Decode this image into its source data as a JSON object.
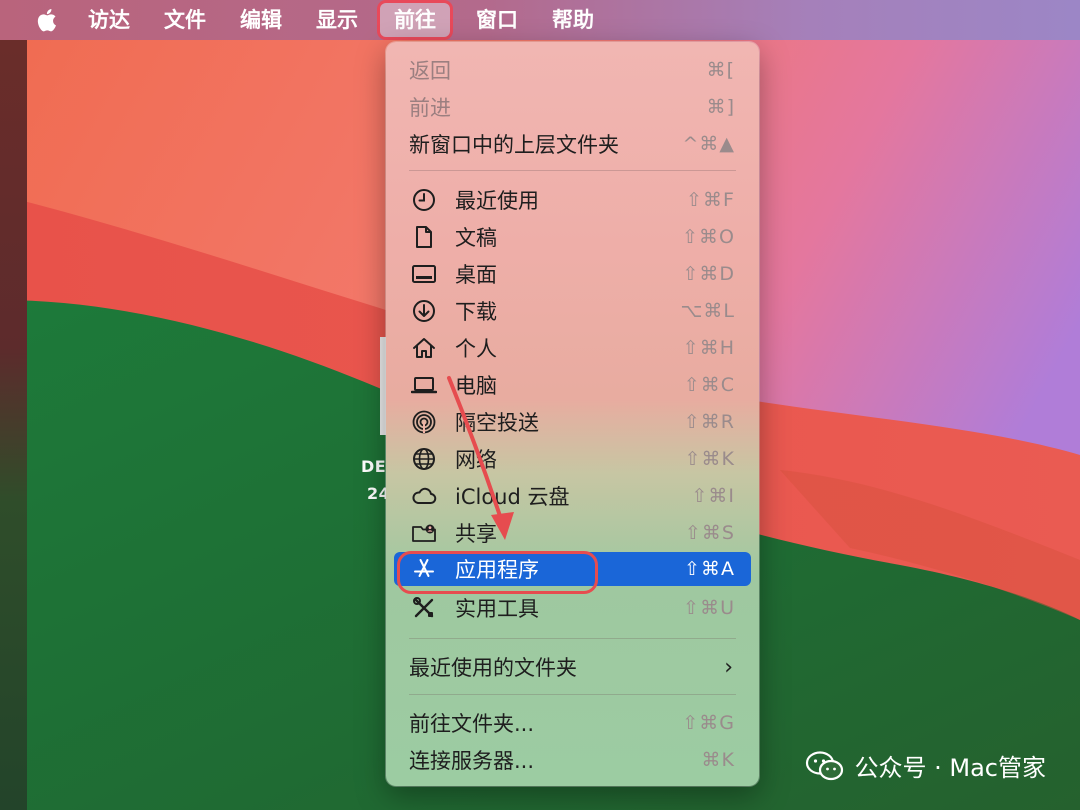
{
  "menubar": {
    "items": [
      {
        "label": "访达",
        "active": false
      },
      {
        "label": "文件",
        "active": false
      },
      {
        "label": "编辑",
        "active": false
      },
      {
        "label": "显示",
        "active": false
      },
      {
        "label": "前往",
        "active": true
      },
      {
        "label": "窗口",
        "active": false
      },
      {
        "label": "帮助",
        "active": false
      }
    ]
  },
  "desktop": {
    "label_line1": "DE",
    "label_line2": "24"
  },
  "go_menu": {
    "back": {
      "label": "返回",
      "shortcut": "⌘[",
      "enabled": false
    },
    "forward": {
      "label": "前进",
      "shortcut": "⌘]",
      "enabled": false
    },
    "enclosing": {
      "label": "新窗口中的上层文件夹",
      "shortcut": "^⌘▲"
    },
    "recents": {
      "label": "最近使用",
      "shortcut": "⇧⌘F",
      "icon": "clock-icon"
    },
    "documents": {
      "label": "文稿",
      "shortcut": "⇧⌘O",
      "icon": "document-icon"
    },
    "desktop": {
      "label": "桌面",
      "shortcut": "⇧⌘D",
      "icon": "desktop-icon"
    },
    "downloads": {
      "label": "下载",
      "shortcut": "⌥⌘L",
      "icon": "download-icon"
    },
    "home": {
      "label": "个人",
      "shortcut": "⇧⌘H",
      "icon": "home-icon"
    },
    "computer": {
      "label": "电脑",
      "shortcut": "⇧⌘C",
      "icon": "laptop-icon"
    },
    "airdrop": {
      "label": "隔空投送",
      "shortcut": "⇧⌘R",
      "icon": "airdrop-icon"
    },
    "network": {
      "label": "网络",
      "shortcut": "⇧⌘K",
      "icon": "globe-icon"
    },
    "icloud": {
      "label": "iCloud 云盘",
      "shortcut": "⇧⌘I",
      "icon": "cloud-icon"
    },
    "shared": {
      "label": "共享",
      "shortcut": "⇧⌘S",
      "icon": "shared-folder-icon"
    },
    "applications": {
      "label": "应用程序",
      "shortcut": "⇧⌘A",
      "icon": "app-store-icon",
      "highlighted": true
    },
    "utilities": {
      "label": "实用工具",
      "shortcut": "⇧⌘U",
      "icon": "tools-icon"
    },
    "recent_folders": {
      "label": "最近使用的文件夹"
    },
    "go_to_folder": {
      "label": "前往文件夹...",
      "shortcut": "⇧⌘G"
    },
    "connect_server": {
      "label": "连接服务器...",
      "shortcut": "⌘K"
    }
  },
  "watermark": {
    "text": "公众号 · Mac管家"
  },
  "colors": {
    "highlight": "#1a66d8",
    "annotation": "#e64c4f"
  }
}
